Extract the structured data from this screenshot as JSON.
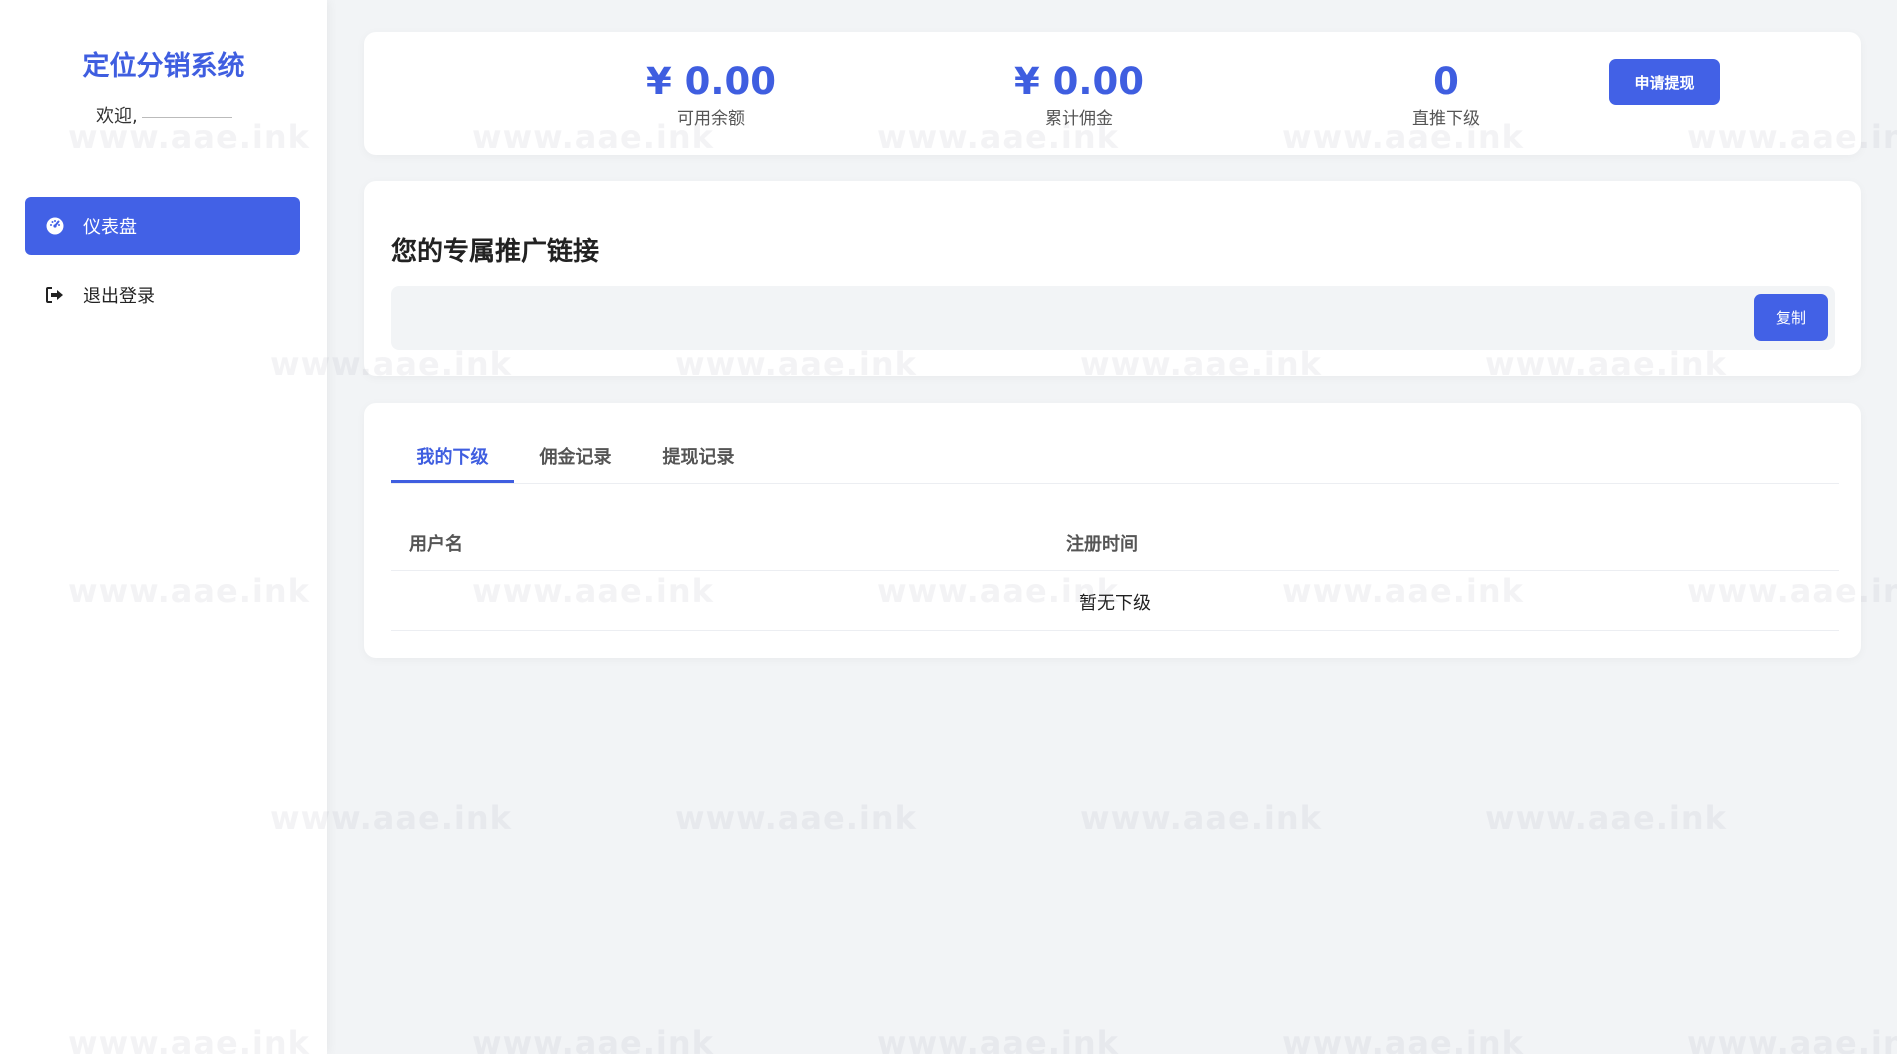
{
  "sidebar": {
    "brand": "定位分销系统",
    "welcome": "欢迎,",
    "nav": [
      {
        "label": "仪表盘",
        "icon": "dashboard-icon",
        "active": true
      },
      {
        "label": "退出登录",
        "icon": "logout-icon",
        "active": false
      }
    ]
  },
  "stats": {
    "available": {
      "value": "¥ 0.00",
      "label": "可用余额"
    },
    "commission": {
      "value": "¥ 0.00",
      "label": "累计佣金"
    },
    "direct": {
      "value": "0",
      "label": "直推下级"
    },
    "withdraw_button": "申请提现"
  },
  "promo": {
    "title": "您的专属推广链接",
    "link_value": "",
    "copy_button": "复制"
  },
  "tabs": [
    {
      "label": "我的下级",
      "active": true
    },
    {
      "label": "佣金记录",
      "active": false
    },
    {
      "label": "提现记录",
      "active": false
    }
  ],
  "table": {
    "headers": [
      "用户名",
      "注册时间"
    ],
    "empty_text": "暂无下级"
  },
  "watermark": "www.aae.ink",
  "colors": {
    "accent": "#4261e6",
    "background": "#f2f4f6"
  }
}
